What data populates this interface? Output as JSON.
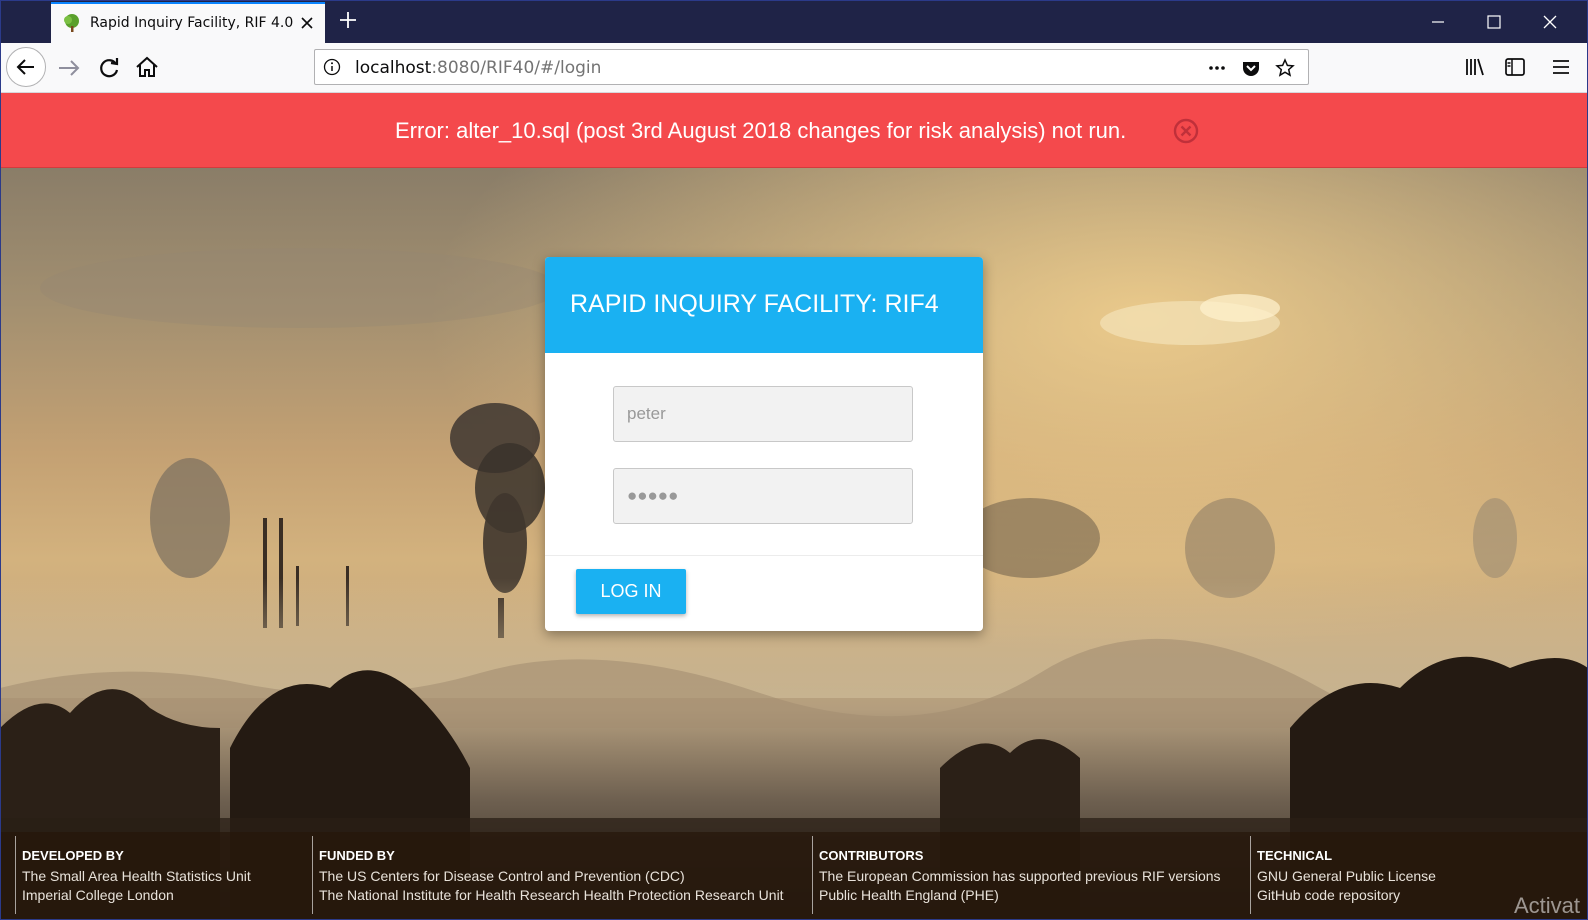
{
  "browser": {
    "tab_title": "Rapid Inquiry Facility, RIF 4.0",
    "url_host": "localhost",
    "url_rest": ":8080/RIF40/#/login",
    "icons": {
      "favicon": "tree-icon",
      "tab_close": "close-icon",
      "new_tab": "plus-icon",
      "minimize": "minimize-icon",
      "maximize": "maximize-icon",
      "close_window": "close-window-icon",
      "back": "back-arrow-icon",
      "forward": "forward-arrow-icon",
      "reload": "reload-icon",
      "home": "home-icon",
      "site_info": "info-icon",
      "page_actions": "ellipsis-icon",
      "pocket": "pocket-icon",
      "bookmark": "star-icon",
      "library": "library-icon",
      "sidebar": "sidebar-icon",
      "menu": "hamburger-menu-icon"
    }
  },
  "error_banner": {
    "message": "Error: alter_10.sql (post 3rd August 2018 changes for risk analysis) not run.",
    "close_icon": "circle-close-icon",
    "color": "#f4494c"
  },
  "login": {
    "title": "RAPID INQUIRY FACILITY: RIF4",
    "username_value": "peter",
    "password_value": "●●●●●",
    "login_button": "LOG IN",
    "accent_color": "#1ab1f2"
  },
  "footer": {
    "columns": [
      {
        "title": "DEVELOPED BY",
        "lines": [
          "The Small Area Health Statistics Unit",
          "Imperial College London"
        ]
      },
      {
        "title": "FUNDED BY",
        "lines": [
          "The US Centers for Disease Control and Prevention (CDC)",
          "The National Institute for Health Research Health Protection Research Unit"
        ]
      },
      {
        "title": "CONTRIBUTORS",
        "lines": [
          "The European Commission has supported previous RIF versions",
          "Public Health England (PHE)"
        ]
      },
      {
        "title": "TECHNICAL",
        "lines": [
          "GNU General Public License",
          "GitHub code repository"
        ]
      }
    ]
  },
  "watermark": "Activat"
}
